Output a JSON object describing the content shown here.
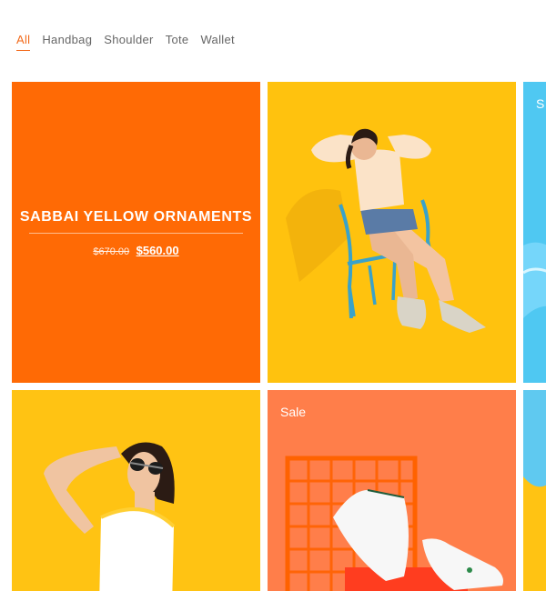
{
  "tabs": [
    {
      "label": "All",
      "active": true
    },
    {
      "label": "Handbag",
      "active": false
    },
    {
      "label": "Shoulder",
      "active": false
    },
    {
      "label": "Tote",
      "active": false
    },
    {
      "label": "Wallet",
      "active": false
    }
  ],
  "promo": {
    "title": "SABBAI YELLOW ORNAMENTS",
    "old_price": "$670.00",
    "new_price": "$560.00"
  },
  "badges": {
    "top_right_partial": "S",
    "bottom_middle": "Sale"
  },
  "colors": {
    "accent": "#f26a1b",
    "promo_bg": "#ff6a05",
    "yellow_bg": "#ffc20e",
    "blue_bg": "#4fc8f2",
    "coral_bg": "#ff7e4a"
  }
}
